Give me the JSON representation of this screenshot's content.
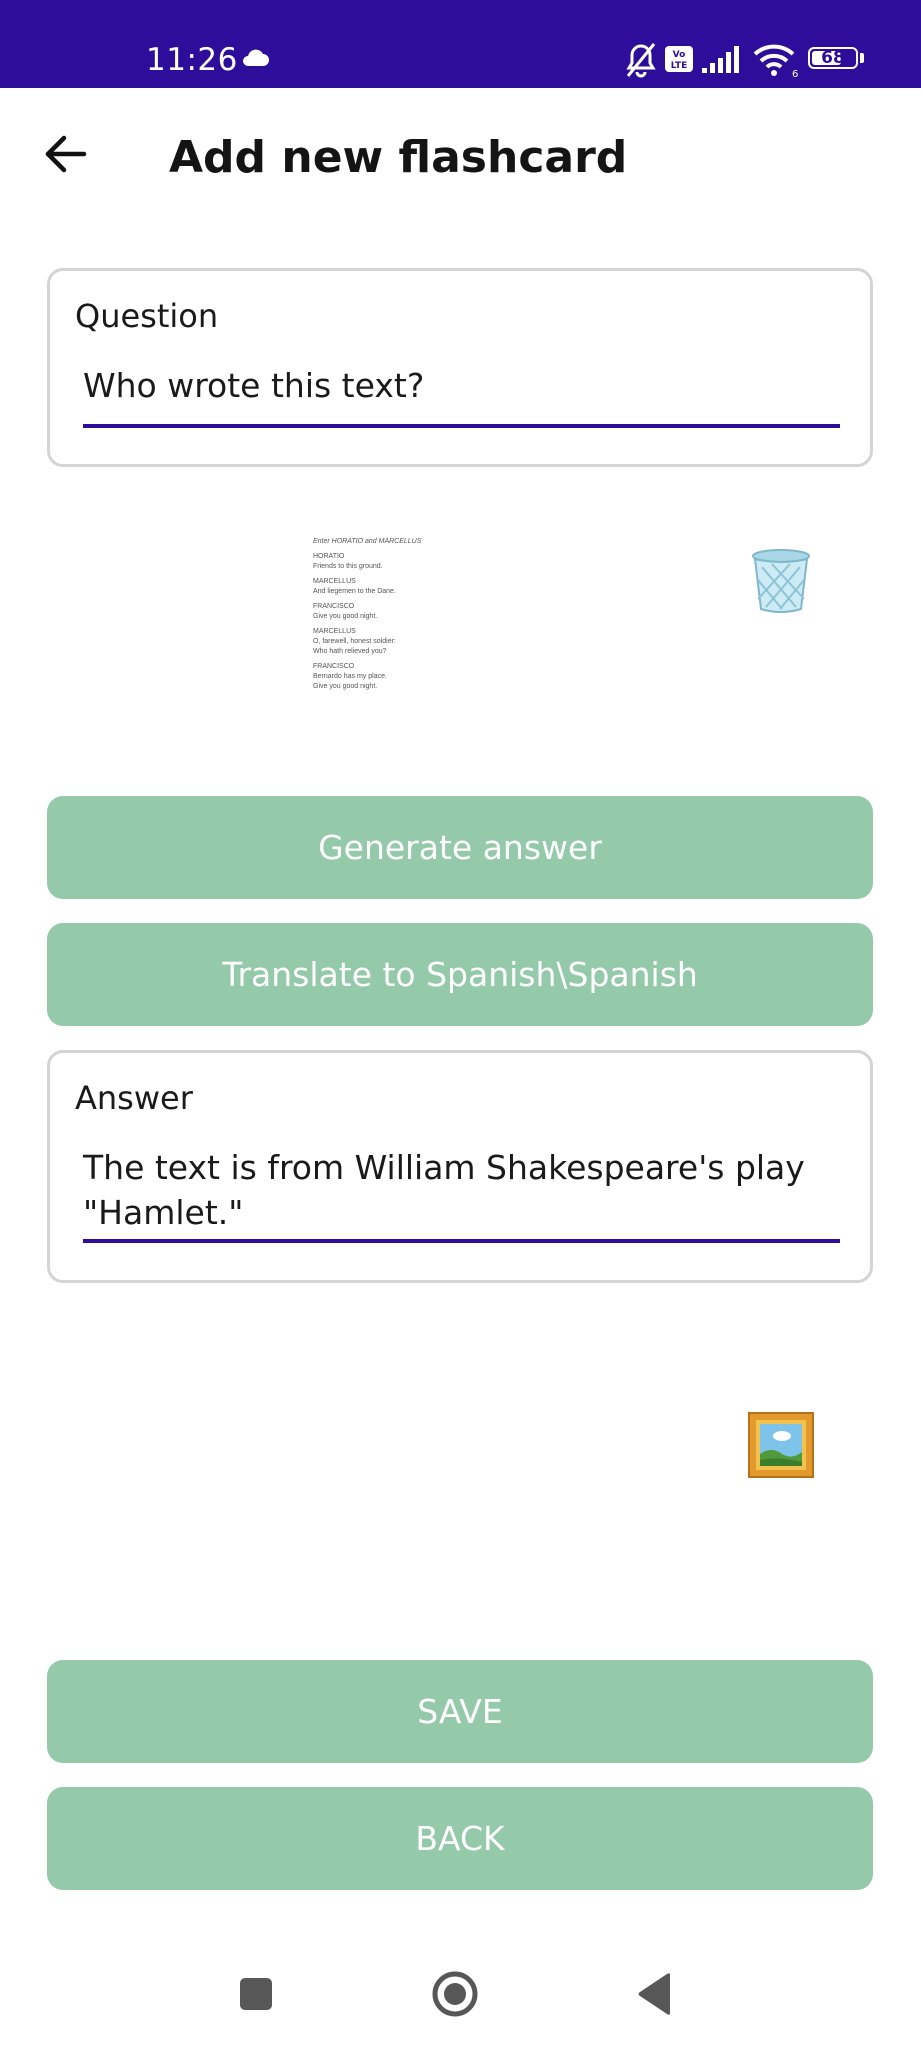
{
  "status_bar": {
    "time": "11:26",
    "battery": "68",
    "battery_level": 0.68,
    "icons": [
      "cloud-icon",
      "mute-icon",
      "volte-icon",
      "signal-icon",
      "wifi-icon",
      "battery-icon"
    ]
  },
  "app_bar": {
    "title": "Add new flashcard",
    "back_icon": "back-arrow-icon"
  },
  "question": {
    "label": "Question",
    "value": "Who wrote this text?"
  },
  "script_image": {
    "lines": [
      [
        "Enter HORATIO and MARCELLUS"
      ],
      [
        "HORATIO",
        "Friends to this ground."
      ],
      [
        "MARCELLUS",
        "And liegemen to the Dane."
      ],
      [
        "FRANCISCO",
        "Give you good night."
      ],
      [
        "MARCELLUS",
        "O, farewell, honest soldier:",
        "Who hath relieved you?"
      ],
      [
        "FRANCISCO",
        "Bernardo has my place.",
        "Give you good night."
      ]
    ]
  },
  "buttons": {
    "generate": "Generate answer",
    "translate": "Translate to Spanish\\Spanish",
    "save": "SAVE",
    "back": "BACK"
  },
  "answer": {
    "label": "Answer",
    "value": "The text is from William Shakespeare's play \"Hamlet.\""
  },
  "colors": {
    "accent": "#2e0d9b",
    "button": "#94c9a9",
    "button_text": "#ffffff"
  }
}
